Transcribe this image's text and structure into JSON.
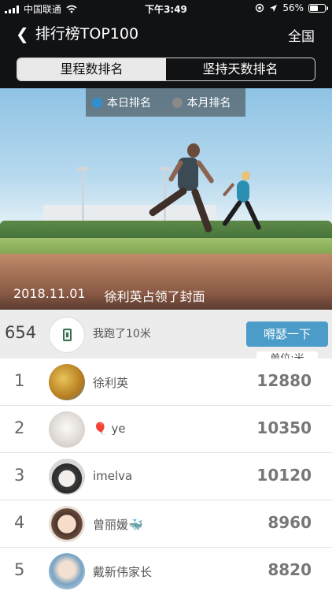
{
  "status_bar": {
    "carrier": "中国联通",
    "time": "下午3:49",
    "battery": "56%",
    "battery_level": 0.56
  },
  "header": {
    "back_label": "排行榜TOP100",
    "right_label": "全国"
  },
  "tabs": {
    "distance_label": "里程数排名",
    "persist_label": "坚持天数排名"
  },
  "period_toggle": {
    "today_label": "本日排名",
    "month_label": "本月排名"
  },
  "cover": {
    "date": "2018.11.01",
    "text": "徐利英占领了封面"
  },
  "mine": {
    "rank": "654",
    "text": "我跑了10米",
    "button_label": "嘚瑟一下"
  },
  "unit_label": "单位:米",
  "ranking": [
    {
      "rank": "1",
      "name": "徐利英",
      "value": "12880",
      "avatar_color": "#c9982e"
    },
    {
      "rank": "2",
      "name": "🎈 ye",
      "value": "10350",
      "avatar_color": "#e8e3de"
    },
    {
      "rank": "3",
      "name": "imelva",
      "value": "10120",
      "avatar_color": "#cfcfcf"
    },
    {
      "rank": "4",
      "name": "曾丽媛🐳",
      "value": "8960",
      "avatar_color": "#f0d2c0"
    },
    {
      "rank": "5",
      "name": "戴新伟家长",
      "value": "8820",
      "avatar_color": "#b8cfe0"
    }
  ]
}
